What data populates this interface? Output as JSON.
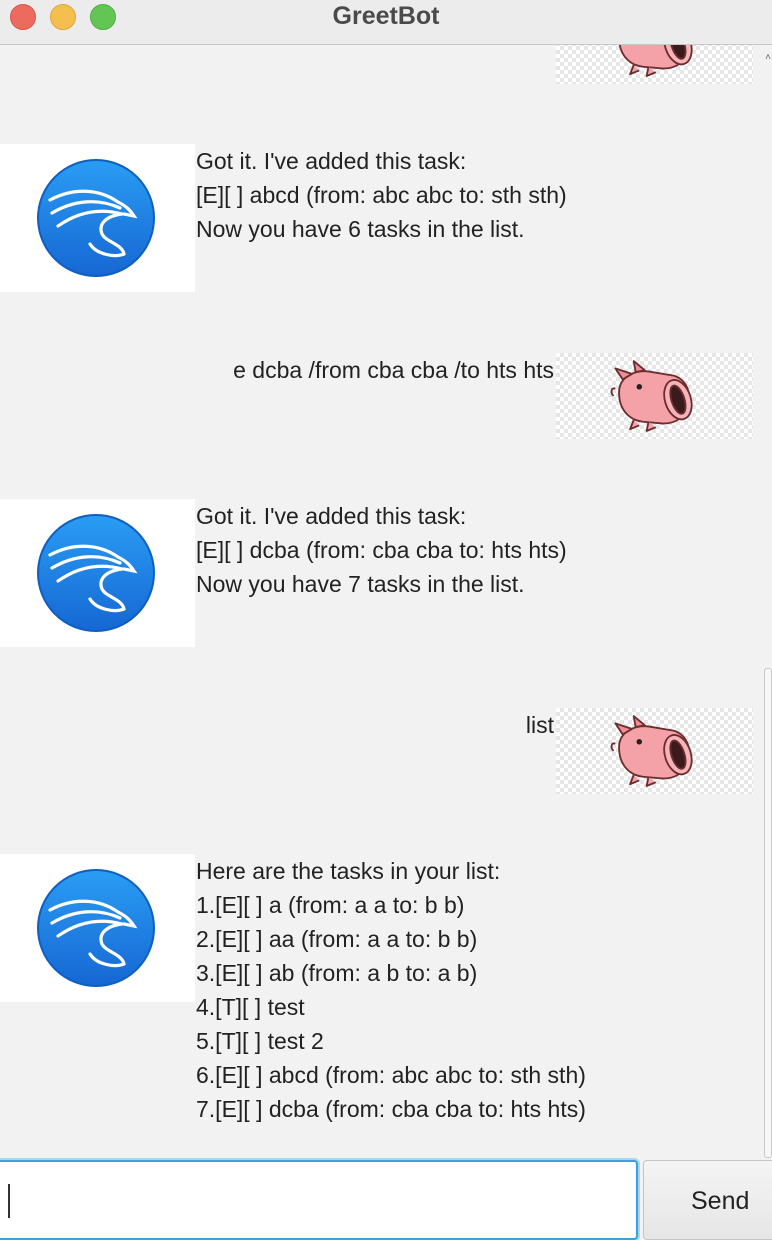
{
  "window": {
    "title": "GreetBot"
  },
  "messages": [
    {
      "sender": "bot",
      "text": "Got it. I've added this task:\n[E][ ] abcd (from: abc abc to: sth sth)\nNow you have 6 tasks in the list."
    },
    {
      "sender": "user",
      "text": "e dcba /from cba cba /to hts hts"
    },
    {
      "sender": "bot",
      "text": "Got it. I've added this task:\n[E][ ] dcba (from: cba cba to: hts hts)\nNow you have 7 tasks in the list."
    },
    {
      "sender": "user",
      "text": "list"
    },
    {
      "sender": "bot",
      "text": "Here are the tasks in your list:\n1.[E][ ] a (from: a a to: b b)\n2.[E][ ] aa (from: a a to: b b)\n3.[E][ ] ab (from: a b to: a b)\n4.[T][ ] test\n5.[T][ ] test 2\n6.[E][ ] abcd (from: abc abc to: sth sth)\n7.[E][ ] dcba (from: cba cba to: hts hts)"
    }
  ],
  "input": {
    "value": "",
    "placeholder": ""
  },
  "send_button": {
    "label": "Send"
  },
  "icons": {
    "bot_avatar": "dragon-logo-icon",
    "user_avatar": "pig-icon"
  },
  "colors": {
    "bot_avatar_blue": "#1f7fe6",
    "input_focus_border": "#3aa2d8",
    "window_background": "#f2f2f2"
  }
}
